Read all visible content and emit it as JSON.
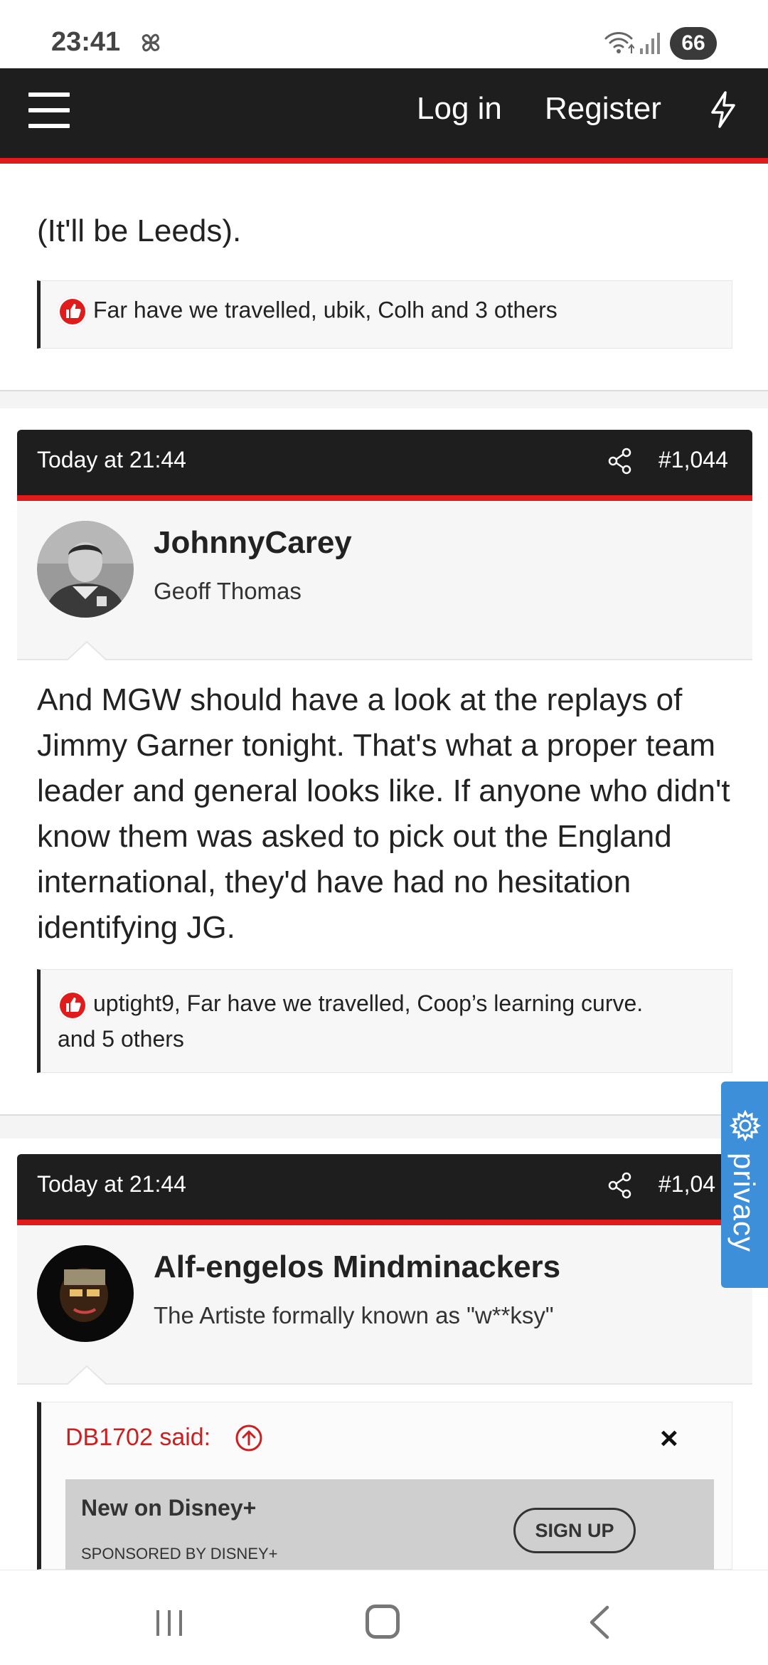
{
  "status_bar": {
    "time": "23:41",
    "battery": "66",
    "icons": [
      "pinwheel-icon",
      "wifi-icon",
      "signal-icon",
      "battery-icon"
    ]
  },
  "nav": {
    "login": "Log in",
    "register": "Register",
    "icons": [
      "menu-icon",
      "bolt-icon"
    ]
  },
  "prev_post": {
    "text": "(It'll be Leeds).",
    "reactions": "Far have we travelled, ubik, Colh and 3 others"
  },
  "post1": {
    "date": "Today at 21:44",
    "number": "#1,044",
    "username": "JohnnyCarey",
    "user_title": "Geoff Thomas",
    "body": "And MGW should have a look at the replays of Jimmy Garner tonight. That's what a proper team leader and general looks like. If anyone who didn't know them was asked to pick out the England international, they'd have had no hesitation identifying JG.",
    "reactions_line1": "uptight9, Far have we travelled, Coop’s learning curve.",
    "reactions_line2": "and 5 others"
  },
  "post2": {
    "date": "Today at 21:44",
    "number": "#1,04",
    "username": "Alf-engelos Mindminackers",
    "user_title": "The Artiste formally known as \"w**ksy\"",
    "quote_author": "DB1702 said:",
    "quote_close": "×"
  },
  "ad": {
    "title": "New on Disney+",
    "sponsor": "SPONSORED BY DISNEY+",
    "button": "SIGN UP"
  },
  "privacy": {
    "label": "privacy"
  },
  "colors": {
    "nav_bg": "#1e1e1e",
    "accent_red": "#e01b1b",
    "privacy_blue": "#3d8fd9"
  }
}
